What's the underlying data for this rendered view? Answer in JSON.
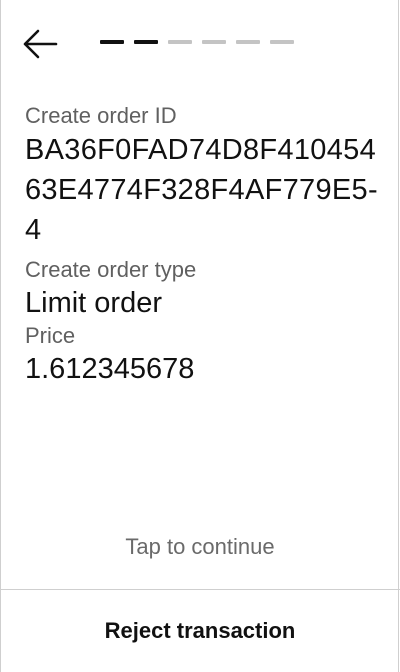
{
  "header": {
    "back_icon": "arrow-left-icon",
    "progress": {
      "total_steps": 6,
      "completed_steps": 2,
      "active_color": "#111111",
      "inactive_color": "#c4c4c4"
    }
  },
  "fields": {
    "order_id": {
      "label": "Create order ID",
      "value": "BA36F0FAD74D8F41045463E4774F328F4AF779E5-4"
    },
    "order_type": {
      "label": "Create order type",
      "value": "Limit order"
    },
    "price": {
      "label": "Price",
      "value": "1.612345678"
    }
  },
  "footer": {
    "tap_hint": "Tap to continue",
    "reject_label": "Reject transaction"
  }
}
